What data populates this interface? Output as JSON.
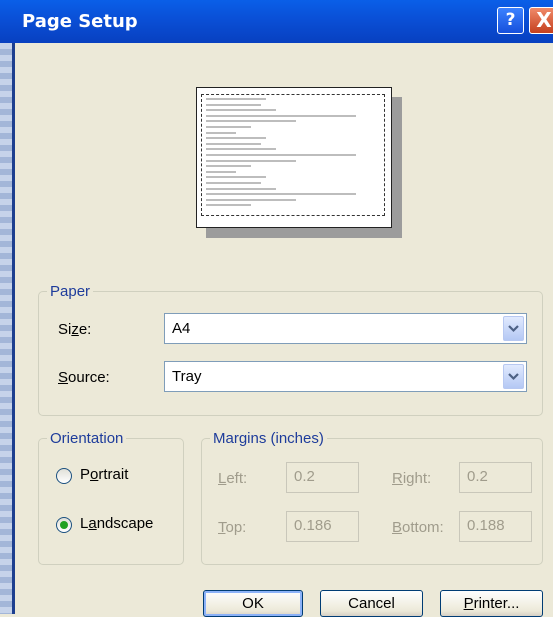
{
  "window": {
    "title": "Page Setup",
    "help_label": "?",
    "close_label": "X"
  },
  "paper": {
    "legend": "Paper",
    "size_label_pre": "Si",
    "size_label_key": "z",
    "size_label_post": "e:",
    "size_value": "A4",
    "source_label_pre": "",
    "source_label_key": "S",
    "source_label_post": "ource:",
    "source_value": "Tray"
  },
  "orientation": {
    "legend": "Orientation",
    "portrait_pre": "P",
    "portrait_key": "o",
    "portrait_post": "rtrait",
    "landscape_pre": "L",
    "landscape_key": "a",
    "landscape_post": "ndscape",
    "selected": "landscape"
  },
  "margins": {
    "legend": "Margins (inches)",
    "left_key": "L",
    "left_rest": "eft:",
    "left_value": "0.2",
    "right_key": "R",
    "right_rest": "ight:",
    "right_value": "0.2",
    "top_key": "T",
    "top_rest": "op:",
    "top_value": "0.186",
    "bottom_key": "B",
    "bottom_rest": "ottom:",
    "bottom_value": "0.188"
  },
  "buttons": {
    "ok": "OK",
    "cancel": "Cancel",
    "printer_key": "P",
    "printer_rest": "rinter..."
  }
}
